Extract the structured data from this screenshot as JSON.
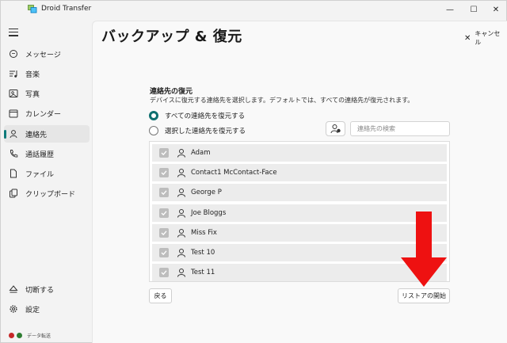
{
  "window": {
    "title": "Droid Transfer"
  },
  "titlebar": {
    "minimize": "—",
    "maximize": "☐",
    "close": "✕"
  },
  "sidebar": {
    "items": [
      {
        "label": "メッセージ",
        "icon": "message-icon"
      },
      {
        "label": "音楽",
        "icon": "music-icon"
      },
      {
        "label": "写真",
        "icon": "photo-icon"
      },
      {
        "label": "カレンダー",
        "icon": "calendar-icon"
      },
      {
        "label": "連絡先",
        "icon": "contacts-icon",
        "active": true
      },
      {
        "label": "通話履歴",
        "icon": "phone-icon"
      },
      {
        "label": "ファイル",
        "icon": "file-icon"
      },
      {
        "label": "クリップボード",
        "icon": "clipboard-icon"
      }
    ],
    "bottom_items": [
      {
        "label": "切断する",
        "icon": "eject-icon"
      },
      {
        "label": "設定",
        "icon": "gear-icon"
      }
    ],
    "status_label": "データ転送",
    "status_colors": [
      "#c62828",
      "#2e7d32"
    ]
  },
  "main": {
    "title": "バックアップ & 復元",
    "cancel_label": "キャンセル",
    "section_title": "連絡先の復元",
    "section_desc": "デバイスに復元する連絡先を選択します。デフォルトでは、すべての連絡先が復元されます。",
    "radio_all": "すべての連絡先を復元する",
    "radio_selected": "選択した連絡先を復元する",
    "search_placeholder": "連絡先の検索",
    "contacts": [
      "Adam",
      "Contact1 McContact-Face",
      "George P",
      "Joe Bloggs",
      "Miss Fix",
      "Test 10",
      "Test 11"
    ],
    "back_label": "戻る",
    "start_label": "リストアの開始"
  },
  "colors": {
    "accent": "#0e6f6f",
    "arrow": "#ee1111"
  }
}
